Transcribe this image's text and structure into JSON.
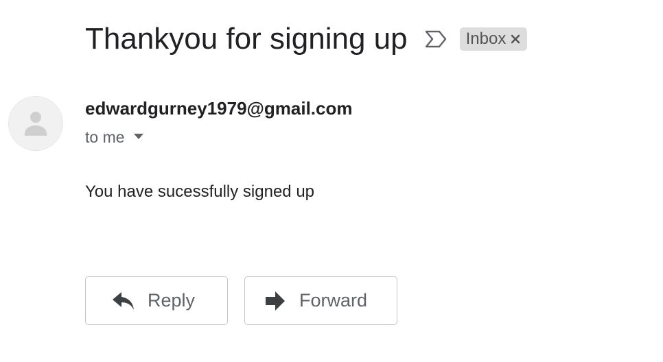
{
  "email": {
    "subject": "Thankyou for signing up",
    "label": "Inbox",
    "sender": "edwardgurney1979@gmail.com",
    "recipient": "to me",
    "body": "You have sucessfully signed up"
  },
  "actions": {
    "reply_label": "Reply",
    "forward_label": "Forward"
  },
  "icons": {
    "importance": "importance-marker-icon",
    "label_remove": "close-icon",
    "avatar": "person-icon",
    "recipient_details": "caret-down-icon",
    "reply": "reply-arrow-icon",
    "forward": "forward-arrow-icon"
  },
  "colors": {
    "text_primary": "#202124",
    "text_secondary": "#5f6368",
    "label_chip_bg": "#dddddd",
    "button_border": "#c7c7c7"
  }
}
